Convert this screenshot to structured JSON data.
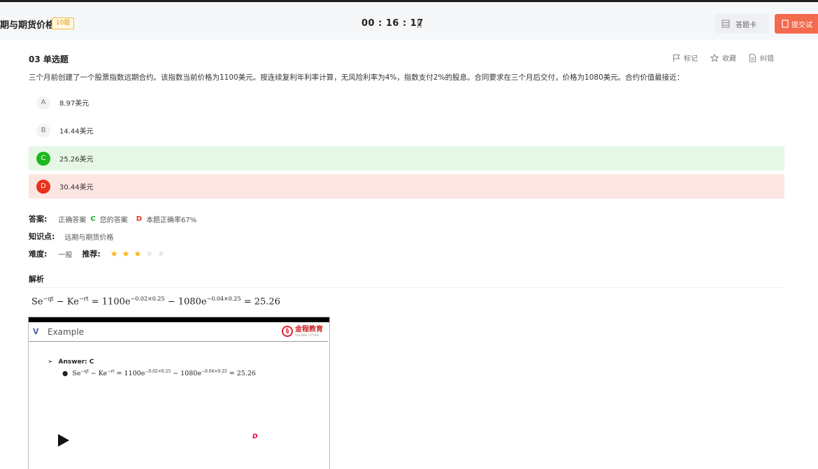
{
  "header": {
    "title": "期与期货价格",
    "badge": "10题",
    "timer": "00 : 16 : 17",
    "pause": "||",
    "answer_card": "答题卡",
    "submit": "提交试"
  },
  "question": {
    "number": "03 单选题",
    "tools": [
      "标记",
      "收藏",
      "纠错"
    ],
    "stem": "三个月前创建了一个股票指数远期合约。该指数当前价格为1100美元。按连续复利年利率计算，无风险利率为4%，指数支付2%的股息。合同要求在三个月后交付，价格为1080美元。合约价值最接近：",
    "options": [
      {
        "letter": "A",
        "text": "8.97美元",
        "state": "none"
      },
      {
        "letter": "B",
        "text": "14.44美元",
        "state": "none"
      },
      {
        "letter": "C",
        "text": "25.26美元",
        "state": "correct"
      },
      {
        "letter": "D",
        "text": "30.44美元",
        "state": "wrong"
      }
    ]
  },
  "answer": {
    "label": "答案:",
    "correct_label": "正确答案",
    "correct_letter": "C",
    "yours_label": "您的答案",
    "yours_letter": "D",
    "rate": "本题正确率67%"
  },
  "knowledge": {
    "label": "知识点:",
    "value": "远期与期货价格"
  },
  "difficulty": {
    "label": "难度:",
    "value": "一般",
    "rec_label": "推荐:",
    "stars": 3,
    "max_stars": 5
  },
  "analysis": {
    "label": "解析"
  },
  "formula": {
    "lhs": "Se",
    "exp1": "−qt",
    "mid": " − Ke",
    "exp2": "−rt",
    "eq": " = 1100e",
    "exp3": "−0.02×0.25",
    "minus": " − 1080e",
    "exp4": "−0.04×0.25",
    "result": " = 25.26"
  },
  "video": {
    "title": "Example",
    "brand": "金程教育",
    "brand_sub": "GOLDEN FUTURE",
    "answer_line": "Answer: C",
    "cursor_glyph": "D"
  }
}
